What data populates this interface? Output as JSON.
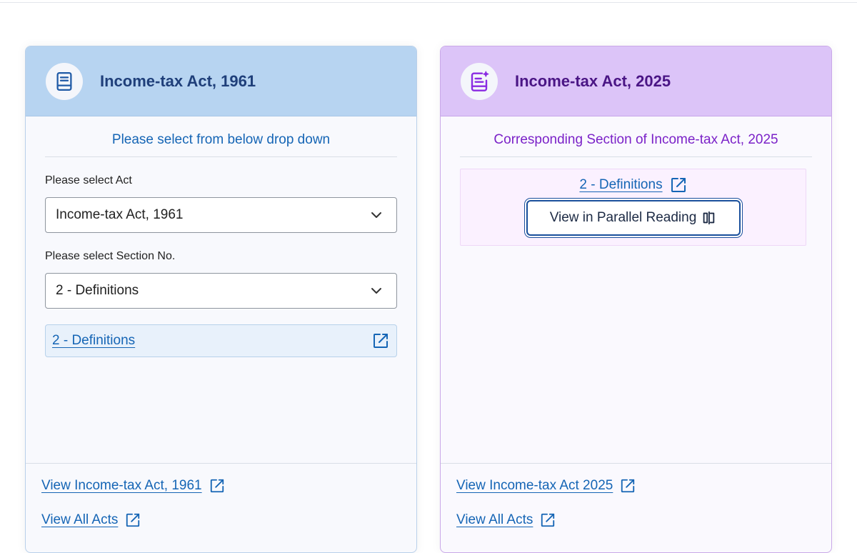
{
  "left_card": {
    "title": "Income-tax Act, 1961",
    "subheading": "Please select from below drop down",
    "act_select_label": "Please select Act",
    "act_select_value": "Income-tax Act, 1961",
    "section_select_label": "Please select Section No.",
    "section_select_value": "2 - Definitions",
    "result_link": "2 - Definitions",
    "footer_links": [
      "View Income-tax Act, 1961",
      "View All Acts"
    ],
    "icon": "book-icon"
  },
  "right_card": {
    "title": "Income-tax Act, 2025",
    "subheading": "Corresponding Section of Income-tax Act, 2025",
    "corresponding_link": "2 - Definitions",
    "parallel_button": "View in Parallel Reading",
    "footer_links": [
      "View Income-tax Act 2025",
      "View All Acts"
    ],
    "icon": "book-sparkle-icon"
  },
  "colors": {
    "link": "#1565b5",
    "left_header_bg": "#b7d4f1",
    "right_header_bg": "#dcc4f8",
    "right_accent": "#7b22c8"
  }
}
